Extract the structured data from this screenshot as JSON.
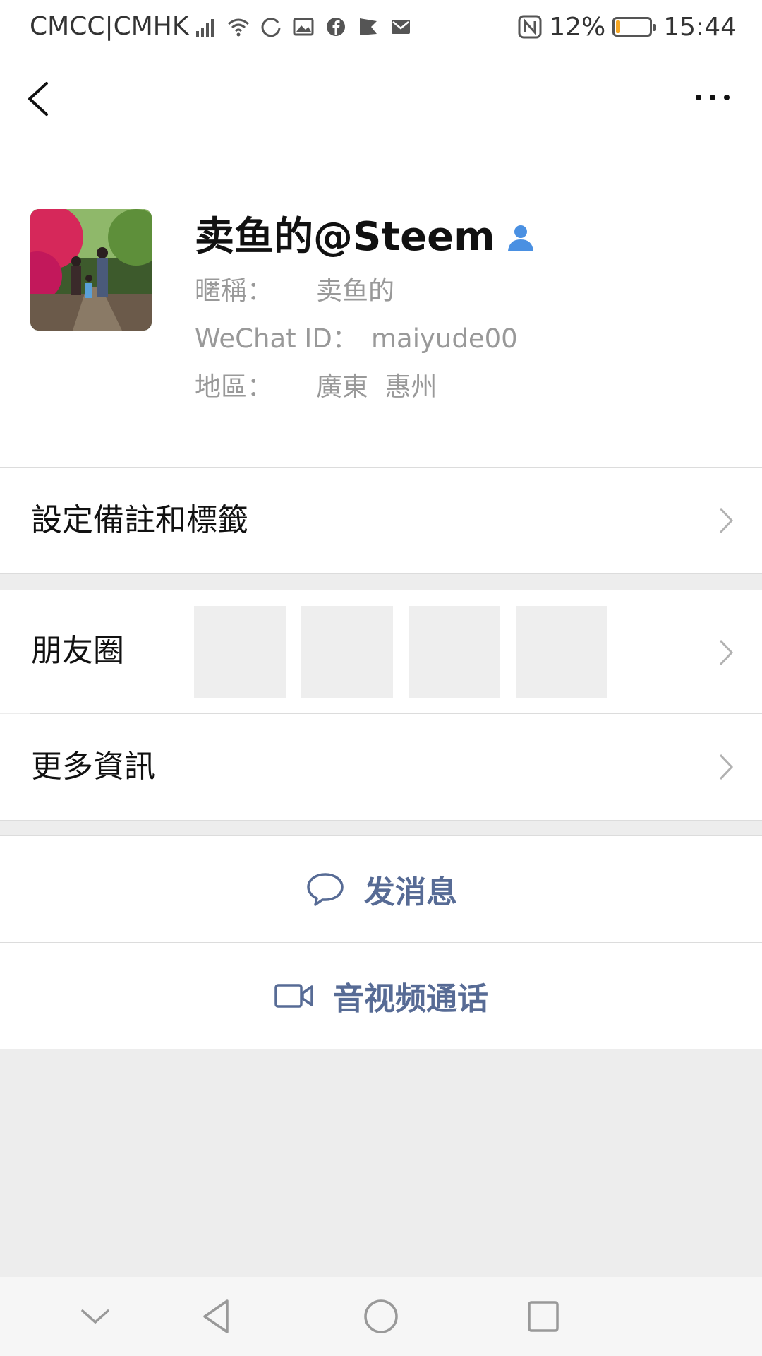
{
  "status_bar": {
    "carrier": "CMCC|CMHK",
    "battery_percent": "12%",
    "battery_level": 0.12,
    "time": "15:44"
  },
  "profile": {
    "display_name": "卖鱼的@Steem",
    "nickname_label": "暱稱：",
    "nickname_value": "卖鱼的",
    "wechat_id_label": "WeChat ID：",
    "wechat_id_value": "maiyude00",
    "region_label": "地區：",
    "region_value": "廣東  惠州"
  },
  "cells": {
    "remark_label": "設定備註和標籤",
    "moments_label": "朋友圈",
    "more_info_label": "更多資訊"
  },
  "actions": {
    "message_label": "发消息",
    "video_call_label": "音视频通话"
  },
  "colors": {
    "link_blue": "#576b95",
    "verified_blue": "#4a90e2",
    "battery_orange": "#f5a623"
  }
}
